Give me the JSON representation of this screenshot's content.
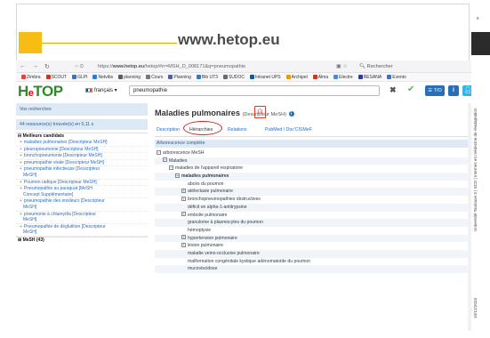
{
  "slide": {
    "title": "www.hetop.eu",
    "footer_vertical": "Université Toulouse 3 | SCD | Internes en médecine de réadaptation",
    "footer_date": "10/12/2023",
    "page_marker": "s",
    "colors": {
      "accent": "#f6bd14"
    }
  },
  "browser": {
    "url_prefix": "https://",
    "url_domain": "www.hetop.eu",
    "url_path": "/hetop/#rr=MSH_D_008171&q=pneumopathie",
    "search_placeholder": "Rechercher",
    "bookmarks": [
      "Zimbra",
      "SCOUT",
      "GLPI",
      "Netvibs",
      "planning",
      "Cours",
      "Planning",
      "Bib UT3",
      "SUDOC",
      "Intranet UPS",
      "Archipel",
      "Alma",
      "Electre",
      "RESANA",
      "Evento"
    ]
  },
  "hetop": {
    "logo_h": "H",
    "logo_e": "e",
    "logo_rest": "TOP",
    "language": "français",
    "query": "pneumopathie",
    "to_button": "T/O",
    "info_button": "i"
  },
  "sidebar": {
    "header": "Vos recherches",
    "count": "44 ressource(s) trouvée(s) en 0,11 s",
    "group_best": "Meilleurs candidats",
    "items": [
      {
        "line1": "maladies pulmonaires [Descripteur MeSH]",
        "line2": ""
      },
      {
        "line1": "pleuropneumonie [Descripteur MeSH]",
        "line2": ""
      },
      {
        "line1": "bronchopneumonie [Descripteur MeSH]",
        "line2": ""
      },
      {
        "line1": "pneumopathie virale [Descripteur MeSH]",
        "line2": ""
      },
      {
        "line1": "pneumopathie infectieuse [Descripteur",
        "line2": "MeSH]"
      },
      {
        "line1": "Poumon radique [Descripteur MeSH]",
        "line2": ""
      },
      {
        "line1": "Pneumopathie au paraquat [MeSH",
        "line2": "Concept Supplémentaire]"
      },
      {
        "line1": "pneumopathie des ensileurs [Descripteur",
        "line2": "MeSH]"
      },
      {
        "line1": "pneumonie à chlamydia [Descripteur",
        "line2": "MeSH]"
      },
      {
        "line1": "Pneumopathie de déglutition [Descripteur",
        "line2": "MeSH]"
      }
    ],
    "group_mesh": "MeSH (43)"
  },
  "main": {
    "title": "Maladies pulmonaires",
    "title_suffix": "(Descripteur MeSH)",
    "tabs": [
      "Description",
      "Hiérarchies",
      "Relations",
      "PubMed / Doc'CISMeF"
    ],
    "tree_header": "Arborescence complète",
    "tree": [
      {
        "label": "arborescence MeSH",
        "level": 0,
        "toggle": "−",
        "bold": false
      },
      {
        "label": "Maladies",
        "level": 1,
        "toggle": "−",
        "bold": false
      },
      {
        "label": "maladies de l'appareil respiratoire",
        "level": 2,
        "toggle": "−",
        "bold": false
      },
      {
        "label": "maladies pulmonaires",
        "level": 3,
        "toggle": "−",
        "bold": true
      },
      {
        "label": "abcès du poumon",
        "level": 4,
        "toggle": "",
        "bold": false
      },
      {
        "label": "atélectasie pulmonaire",
        "level": 4,
        "toggle": "+",
        "bold": false
      },
      {
        "label": "bronchopneumopathies obstructives",
        "level": 4,
        "toggle": "+",
        "bold": false
      },
      {
        "label": "déficit en alpha-1-antitrypsine",
        "level": 4,
        "toggle": "",
        "bold": false
      },
      {
        "label": "embolie pulmonaire",
        "level": 4,
        "toggle": "+",
        "bold": false
      },
      {
        "label": "granulome à plasmocytes du poumon",
        "level": 4,
        "toggle": "",
        "bold": false
      },
      {
        "label": "hémoptysie",
        "level": 4,
        "toggle": "",
        "bold": false
      },
      {
        "label": "hypertension pulmonaire",
        "level": 4,
        "toggle": "+",
        "bold": false
      },
      {
        "label": "lésion pulmonaire",
        "level": 4,
        "toggle": "+",
        "bold": false
      },
      {
        "label": "maladie veino-occlusive pulmonaire",
        "level": 4,
        "toggle": "",
        "bold": false
      },
      {
        "label": "malformation congénitale kystique adénomatoïde du poumon",
        "level": 4,
        "toggle": "",
        "bold": false
      },
      {
        "label": "mucoviscidose",
        "level": 4,
        "toggle": "",
        "bold": false
      }
    ]
  }
}
